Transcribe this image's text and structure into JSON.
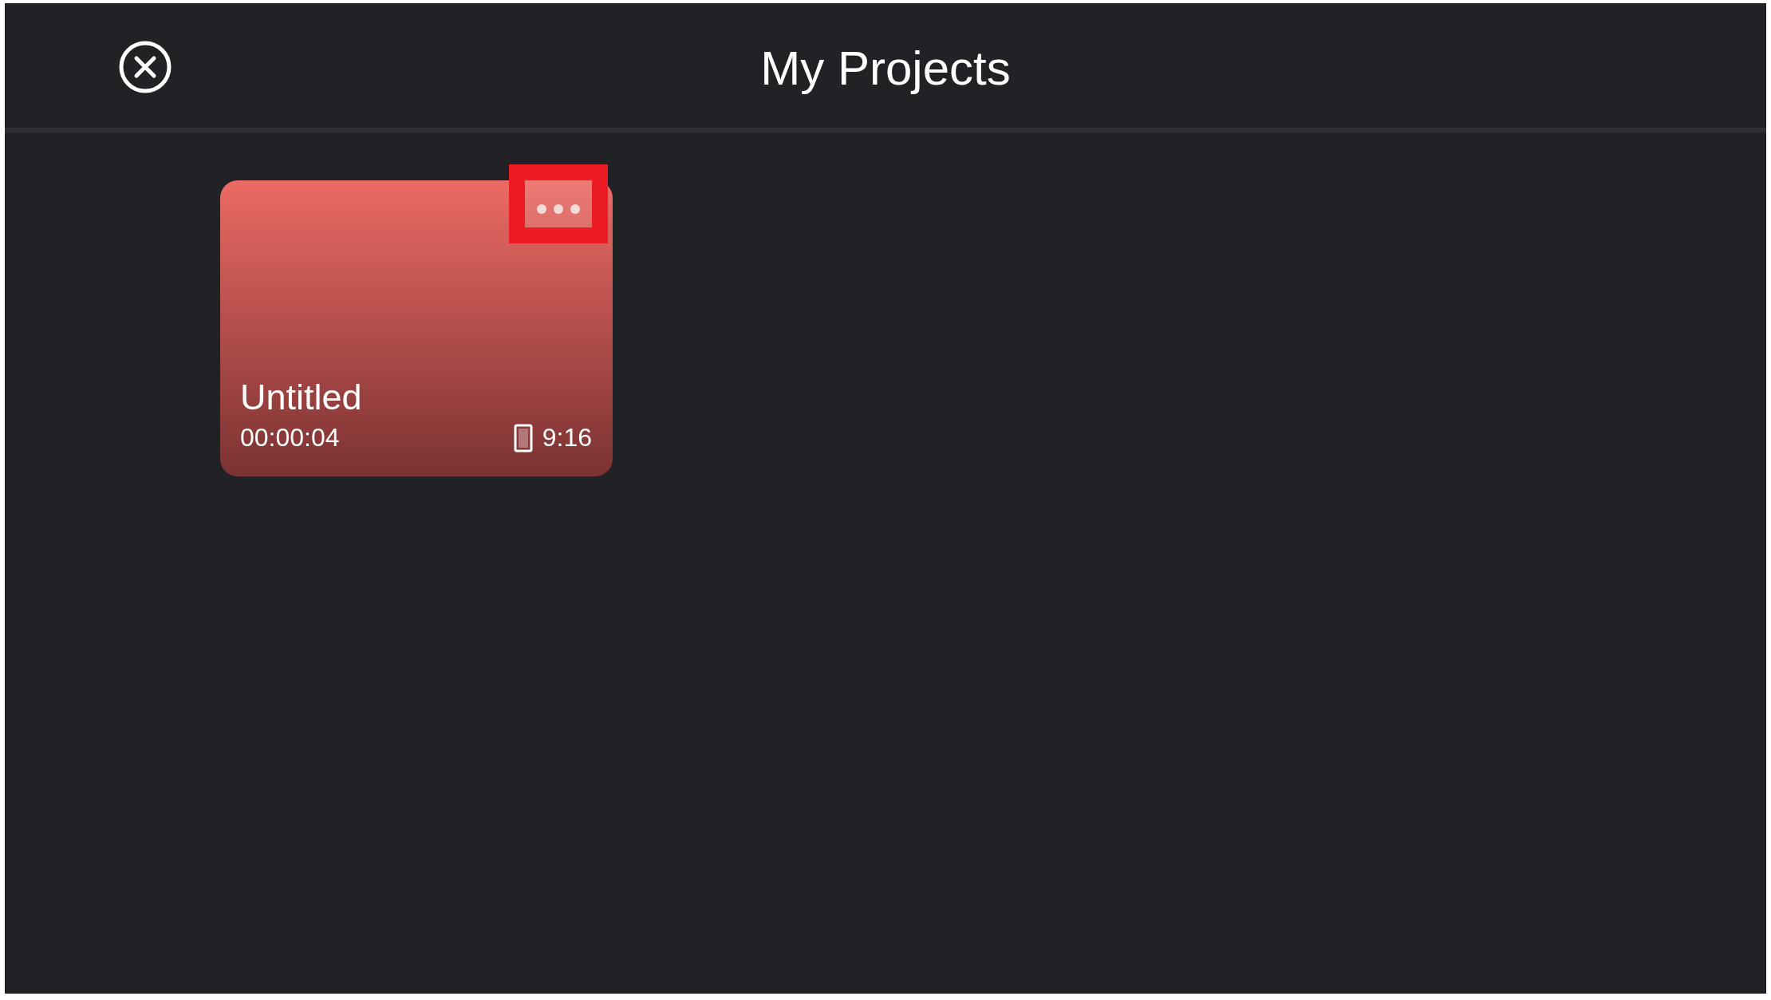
{
  "header": {
    "title": "My Projects"
  },
  "projects": [
    {
      "title": "Untitled",
      "duration": "00:00:04",
      "aspect_ratio": "9:16",
      "menu_highlighted": true
    }
  ]
}
